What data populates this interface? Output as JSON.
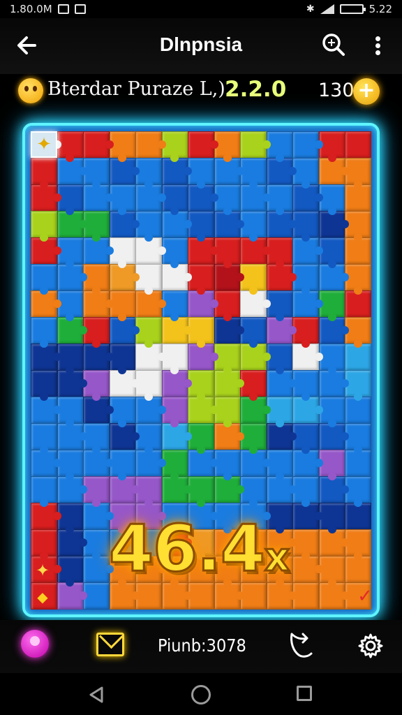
{
  "status_bar": {
    "time_left": "1.80.0M",
    "time_right": "5.22"
  },
  "app_bar": {
    "title": "Dlnpnsia",
    "back_icon": "back-arrow-icon",
    "search_icon": "search-icon",
    "menu_icon": "more-vert-icon"
  },
  "info": {
    "mode_label": "Bterdar Puraze  L,)",
    "level_value": "2.2.0",
    "coins": "130",
    "coin_add_label": "+"
  },
  "board": {
    "multiplier_value": "46.4",
    "multiplier_suffix": "x",
    "colors": {
      "R": "#d81e1e",
      "r": "#b3121a",
      "O": "#f07d16",
      "o": "#ef9a26",
      "Y": "#f3c21b",
      "L": "#a9d21c",
      "G": "#1fae3a",
      "g": "#12923a",
      "B": "#1a7ce0",
      "b": "#1359c2",
      "N": "#0f3594",
      "P": "#9657c9",
      "p": "#7c4ac4",
      "W": "#f0f0f0",
      "C": "#2da6e6",
      "M": "#c0268c"
    },
    "grid": [
      "WRROOLROLBBRR",
      "RBBbBbBBBbBOO",
      "RbBBBbbBBBbBO",
      "LGGbBBbbBbbNO",
      "RBBWWBRRRRBbO",
      "BBOoWWRrYRBBO",
      "OBOOOBPRWbBGR",
      "BGRbLYYNbPRbO",
      "NNNNWWPLLbWBC",
      "NNPWWPLLRBBBC",
      "BBNBBPLLGCCBB",
      "BBBNBCGOGNbbB",
      "BBBBBGBBBBBPB",
      "BBPPPGGGBBBbB",
      "RNBPPBBBBNNNN",
      "RNBBBRoOOOOOO",
      "RNBOOOOOOOOOO",
      "RPBOOOOOOOOOO"
    ],
    "knobs": [
      [
        "C",
        "B",
        "O",
        "R",
        "B",
        "L",
        "R",
        "B",
        "B",
        "R",
        "N",
        "B",
        "C",
        "R",
        "O",
        "G",
        "B",
        "Y",
        "O",
        "P",
        "W",
        "R",
        "O",
        "B"
      ],
      [
        "B",
        "R",
        "B",
        "O",
        "N",
        "B",
        "O",
        "R",
        "B",
        "W",
        "B",
        "B",
        "O",
        "R",
        "G",
        "B",
        "P",
        "B",
        "Y",
        "B",
        "O",
        "B",
        "R",
        "N"
      ]
    ]
  },
  "bottom_bar": {
    "score_text": "Piunb:3078",
    "avatar_icon": "avatar-icon",
    "mail_icon": "mail-icon",
    "share_icon": "share-icon",
    "settings_icon": "gear-icon"
  },
  "nav_bar": {
    "back_icon": "nav-back-icon",
    "home_icon": "nav-home-icon",
    "recents_icon": "nav-recents-icon"
  }
}
